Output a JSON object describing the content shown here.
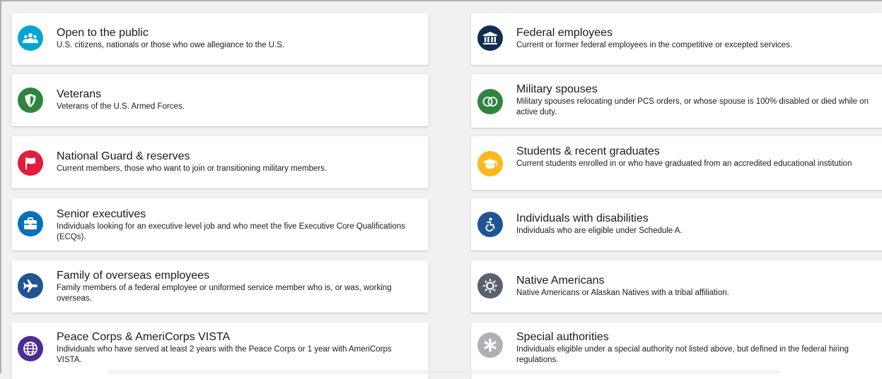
{
  "left_cards": [
    {
      "title": "Open to the public",
      "description": "U.S. citizens, nationals or those who owe allegiance to the U.S.",
      "icon": "people-icon",
      "color": "#00a6d2"
    },
    {
      "title": "Veterans",
      "description": "Veterans of the U.S. Armed Forces.",
      "icon": "shield-icon",
      "color": "#2e8540"
    },
    {
      "title": "National Guard & reserves",
      "description": "Current members, those who want to join or transitioning military members.",
      "icon": "flag-icon",
      "color": "#e31c3d"
    },
    {
      "title": "Senior executives",
      "description": "Individuals looking for an executive level job and who meet the five Executive Core Qualifications (ECQs).",
      "icon": "briefcase-icon",
      "color": "#0071bc"
    },
    {
      "title": "Family of overseas employees",
      "description": "Family members of a federal employee or uniformed service member who is, or was, working overseas.",
      "icon": "airplane-icon",
      "color": "#205493"
    },
    {
      "title": "Peace Corps & AmeriCorps VISTA",
      "description": "Individuals who have served at least 2 years with the Peace Corps or 1 year with AmeriCorps VISTA.",
      "icon": "globe-icon",
      "color": "#4c2c92"
    }
  ],
  "right_cards": [
    {
      "title": "Federal employees",
      "description": "Current or former federal employees in the competitive or excepted services.",
      "icon": "building-icon",
      "color": "#112e51"
    },
    {
      "title": "Military spouses",
      "description": "Military spouses relocating under PCS orders, or whose spouse is 100% disabled or died while on active duty.",
      "icon": "rings-icon",
      "color": "#2e8540"
    },
    {
      "title": "Students & recent graduates",
      "description": "Current students enrolled in or who have graduated from an accredited educational institution",
      "icon": "graduation-cap-icon",
      "color": "#fdb81e"
    },
    {
      "title": "Individuals with disabilities",
      "description": "Individuals who are eligible under Schedule A.",
      "icon": "accessibility-icon",
      "color": "#205493"
    },
    {
      "title": "Native Americans",
      "description": "Native Americans or Alaskan Natives with a tribal affiliation.",
      "icon": "sun-icon",
      "color": "#5b616b"
    },
    {
      "title": "Special authorities",
      "description": "Individuals eligible under a special authority not listed above, but defined in the federal hiring regulations.",
      "icon": "asterisk-icon",
      "color": "#aeb0b5"
    }
  ]
}
